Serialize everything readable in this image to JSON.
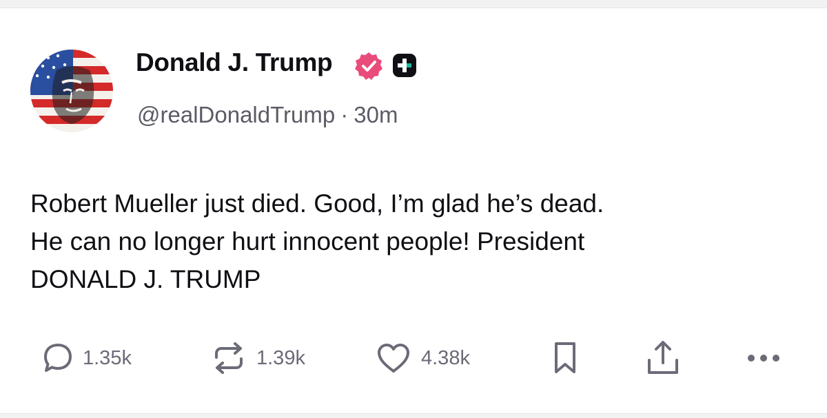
{
  "author": {
    "display_name": "Donald J. Trump",
    "handle": "@realDonaldTrump",
    "separator": "·",
    "time_ago": "30m",
    "verified": true,
    "verified_color": "#e94b7a",
    "badge_color": "#0f0f14"
  },
  "post": {
    "lines": [
      "Robert Mueller just died. Good, I’m glad he’s dead.",
      "He can no longer hurt innocent people! President",
      "DONALD J. TRUMP"
    ]
  },
  "actions": {
    "reply_icon": "reply-bubble-icon",
    "reply_count": "1.35k",
    "repost_icon": "repost-arrows-icon",
    "repost_count": "1.39k",
    "like_icon": "heart-icon",
    "like_count": "4.38k",
    "bookmark_icon": "bookmark-icon",
    "share_icon": "share-upload-icon",
    "more_icon": "more-dots-icon",
    "icon_color": "#6b6b78"
  }
}
